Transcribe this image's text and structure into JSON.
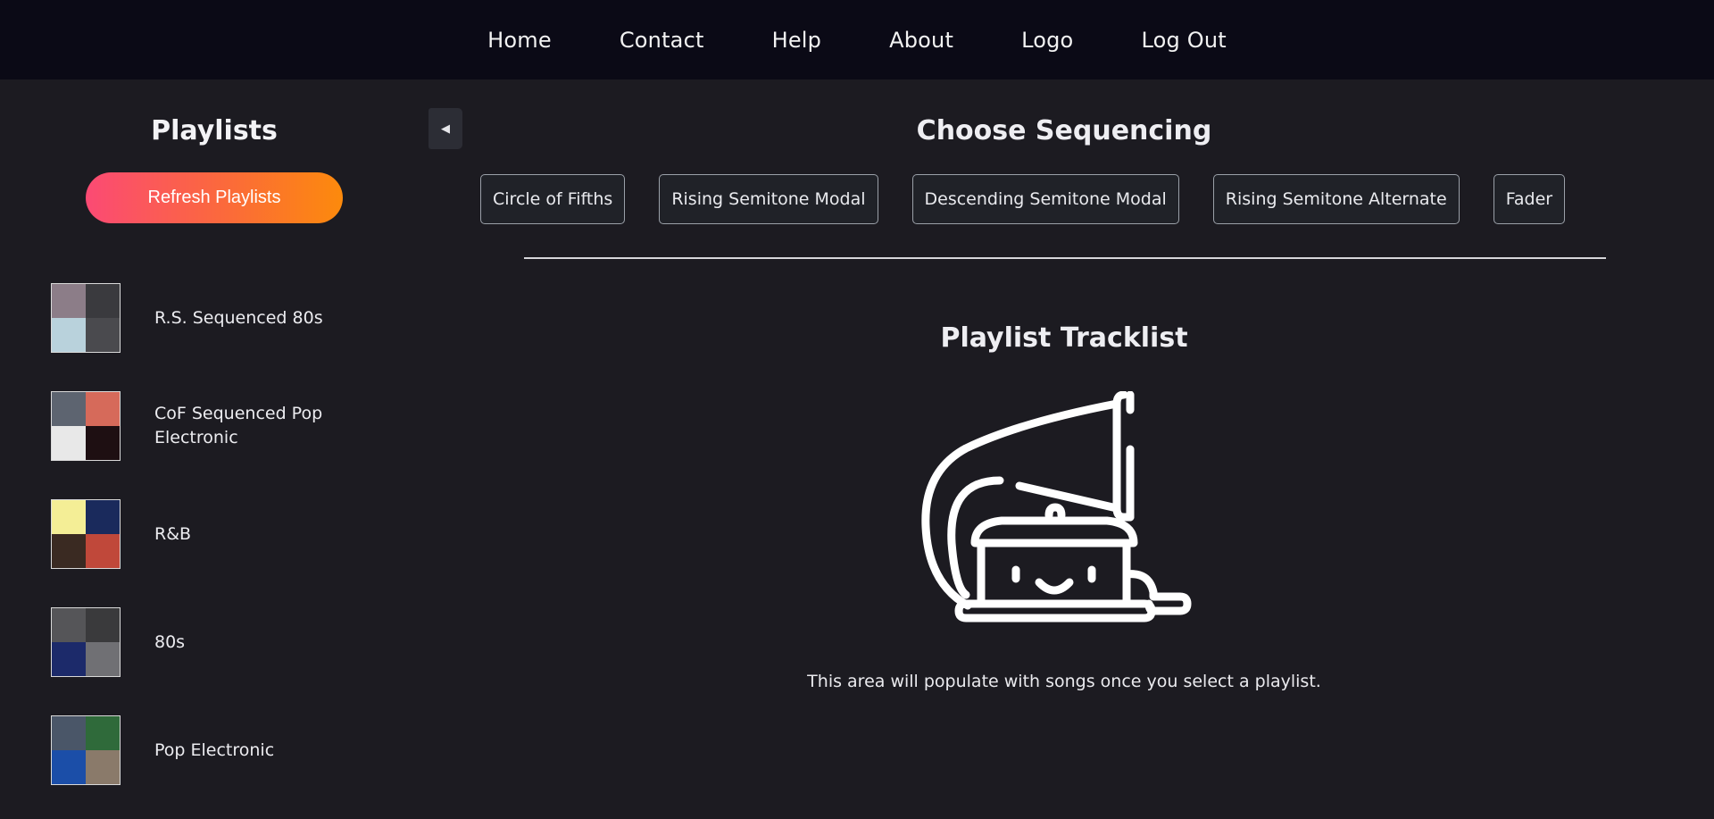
{
  "nav": {
    "items": [
      "Home",
      "Contact",
      "Help",
      "About",
      "Logo",
      "Log Out"
    ]
  },
  "sidebar": {
    "title": "Playlists",
    "refresh_label": "Refresh Playlists",
    "collapse_icon": "chevron-left-icon",
    "playlists": [
      {
        "name": "R.S. Sequenced 80s",
        "cover_colors": [
          "#8c7d88",
          "#3a3a3e",
          "#b9d2dc",
          "#4a4a4e"
        ]
      },
      {
        "name": "CoF Sequenced Pop Electronic",
        "cover_colors": [
          "#5d6470",
          "#d66a5a",
          "#e8e8e8",
          "#1e0f12"
        ]
      },
      {
        "name": "R&B",
        "cover_colors": [
          "#f4ee96",
          "#1a2a5c",
          "#3a2a22",
          "#c0483a"
        ]
      },
      {
        "name": "80s",
        "cover_colors": [
          "#555558",
          "#3a3a3c",
          "#1c2a6a",
          "#707074"
        ]
      },
      {
        "name": "Pop Electronic",
        "cover_colors": [
          "#4a5668",
          "#2f6a3a",
          "#1b4ea8",
          "#8a7a6a"
        ]
      }
    ]
  },
  "main": {
    "sequencing_title": "Choose Sequencing",
    "sequencing_options": [
      "Circle of Fifths",
      "Rising Semitone Modal",
      "Descending Semitone Modal",
      "Rising Semitone Alternate",
      "Fader"
    ],
    "tracklist_title": "Playlist Tracklist",
    "empty_icon": "gramophone-icon",
    "empty_message": "This area will populate with songs once you select a playlist."
  },
  "colors": {
    "nav_bg": "#0b0a16",
    "page_bg": "#1c1b21",
    "accent_gradient_start": "#fb4a74",
    "accent_gradient_end": "#fc8a0c"
  }
}
